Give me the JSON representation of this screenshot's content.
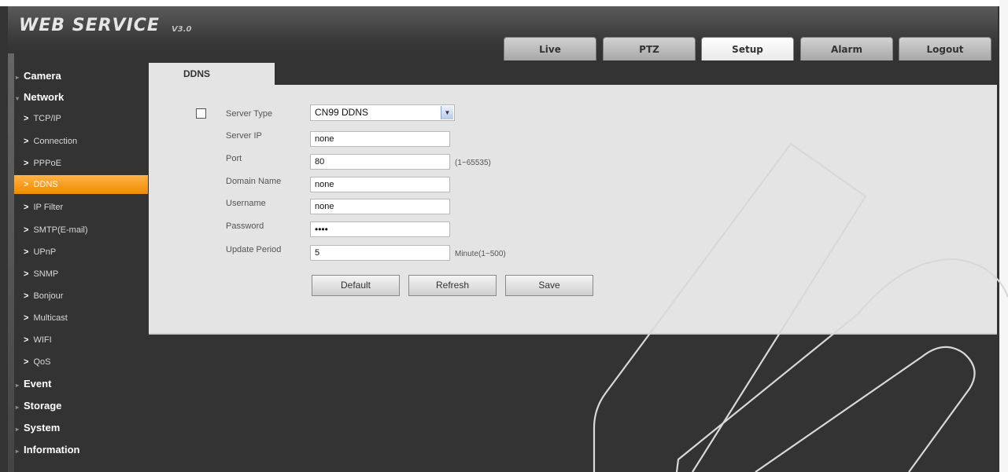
{
  "header": {
    "logo": "WEB  SERVICE",
    "version": "V3.0",
    "tabs": [
      {
        "label": "Live",
        "active": false
      },
      {
        "label": "PTZ",
        "active": false
      },
      {
        "label": "Setup",
        "active": true
      },
      {
        "label": "Alarm",
        "active": false
      },
      {
        "label": "Logout",
        "active": false
      }
    ]
  },
  "sidebar": {
    "camera": "Camera",
    "network": "Network",
    "network_items": [
      "TCP/IP",
      "Connection",
      "PPPoE",
      "DDNS",
      "IP Filter",
      "SMTP(E-mail)",
      "UPnP",
      "SNMP",
      "Bonjour",
      "Multicast",
      "WIFI",
      "QoS"
    ],
    "active_item": "DDNS",
    "event": "Event",
    "storage": "Storage",
    "system": "System",
    "information": "Information"
  },
  "ddns": {
    "tab_label": "DDNS",
    "enable_checked": false,
    "server_type_label": "Server Type",
    "server_type_value": "CN99 DDNS",
    "server_ip_label": "Server IP",
    "server_ip_value": "none",
    "port_label": "Port",
    "port_value": "80",
    "port_hint": "(1~65535)",
    "domain_label": "Domain Name",
    "domain_value": "none",
    "username_label": "Username",
    "username_value": "none",
    "password_label": "Password",
    "password_value": "••••",
    "update_label": "Update Period",
    "update_value": "5",
    "update_hint": "Minute(1~500)",
    "buttons": {
      "default": "Default",
      "refresh": "Refresh",
      "save": "Save"
    }
  },
  "colors": {
    "background": "#333333",
    "panel": "#e4e4e4",
    "active_orange": "#f08a00",
    "text_light": "#ffffff"
  }
}
